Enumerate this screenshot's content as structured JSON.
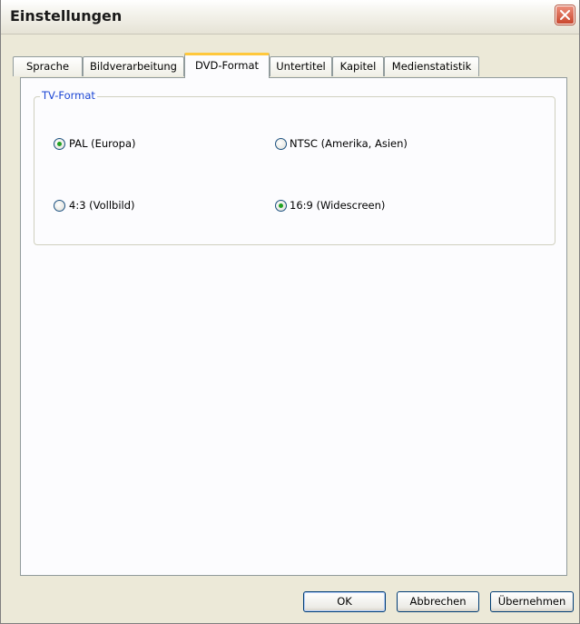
{
  "window": {
    "title": "Einstellungen"
  },
  "tabs": [
    {
      "label": "Sprache",
      "active": false
    },
    {
      "label": "Bildverarbeitung",
      "active": false
    },
    {
      "label": "DVD-Format",
      "active": true
    },
    {
      "label": "Untertitel",
      "active": false
    },
    {
      "label": "Kapitel",
      "active": false
    },
    {
      "label": "Medienstatistik",
      "active": false
    }
  ],
  "group": {
    "legend": "TV-Format",
    "options": [
      {
        "label": "PAL (Europa)",
        "checked": true
      },
      {
        "label": "NTSC (Amerika, Asien)",
        "checked": false
      },
      {
        "label": "4:3 (Vollbild)",
        "checked": false
      },
      {
        "label": "16:9 (Widescreen)",
        "checked": true
      }
    ]
  },
  "buttons": {
    "ok": "OK",
    "cancel": "Abbrechen",
    "apply": "Übernehmen"
  },
  "colors": {
    "accent_tab": "#ffc83c",
    "legend": "#1c46d4",
    "radio_dot": "#21a121",
    "close": "#c9472e"
  }
}
